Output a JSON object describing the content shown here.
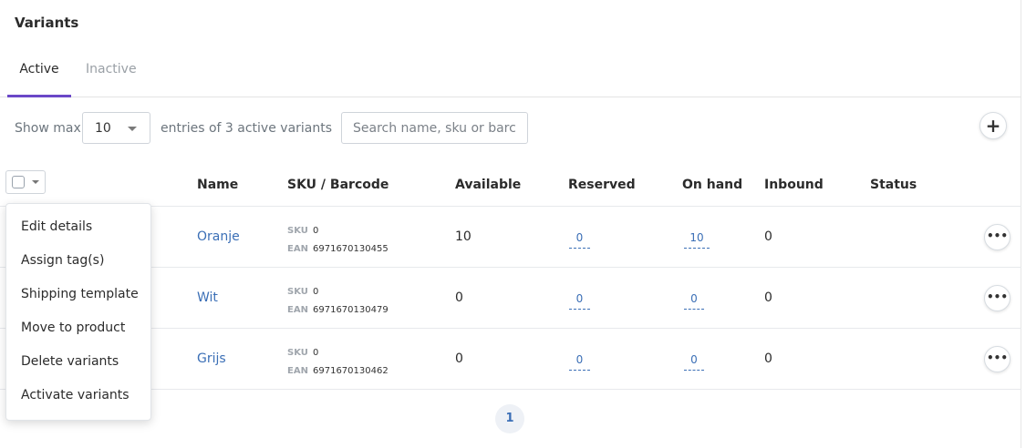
{
  "page": {
    "title": "Variants"
  },
  "tabs": [
    {
      "label": "Active",
      "active": true
    },
    {
      "label": "Inactive",
      "active": false
    }
  ],
  "toolbar": {
    "show_max_label": "Show max.",
    "page_size": "10",
    "entries_text": "entries of 3 active variants",
    "search_placeholder": "Search name, sku or barcode",
    "add_label": "+"
  },
  "table": {
    "headers": [
      "Name",
      "SKU / Barcode",
      "Available",
      "Reserved",
      "On hand",
      "Inbound",
      "Status"
    ],
    "rows": [
      {
        "name": "Oranje",
        "sku_label": "SKU",
        "sku": "0",
        "ean_label": "EAN",
        "ean": "6971670130455",
        "available": "10",
        "reserved": "0",
        "on_hand": "10",
        "inbound": "0",
        "status": ""
      },
      {
        "name": "Wit",
        "sku_label": "SKU",
        "sku": "0",
        "ean_label": "EAN",
        "ean": "6971670130479",
        "available": "0",
        "reserved": "0",
        "on_hand": "0",
        "inbound": "0",
        "status": ""
      },
      {
        "name": "Grijs",
        "sku_label": "SKU",
        "sku": "0",
        "ean_label": "EAN",
        "ean": "6971670130462",
        "available": "0",
        "reserved": "0",
        "on_hand": "0",
        "inbound": "0",
        "status": ""
      }
    ],
    "row_action_label": "•••"
  },
  "bulk_menu": {
    "items": [
      "Edit details",
      "Assign tag(s)",
      "Shipping template",
      "Move to product",
      "Delete variants",
      "Activate variants"
    ]
  },
  "pagination": {
    "current_page": "1"
  },
  "colors": {
    "accent": "#6b48c8",
    "link": "#3b6fb6"
  }
}
